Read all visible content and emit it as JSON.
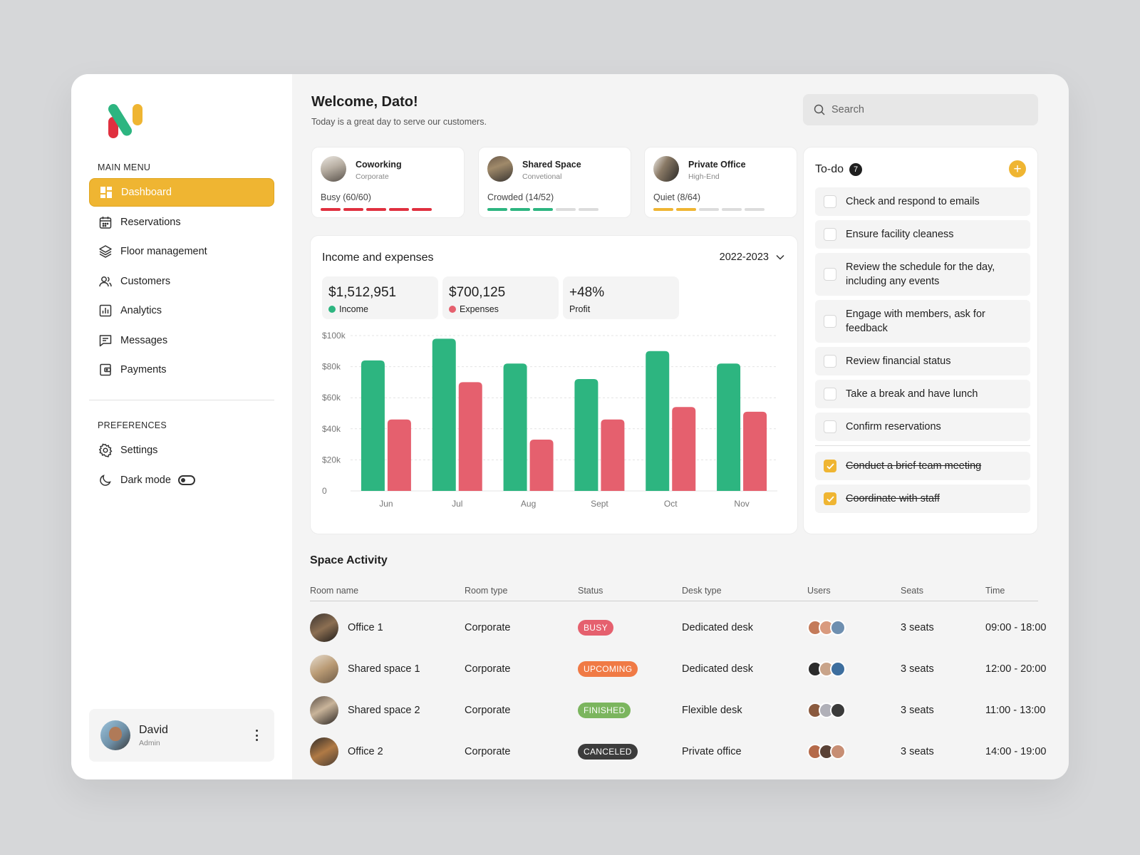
{
  "sidebar": {
    "main_menu_title": "MAIN MENU",
    "preferences_title": "PREFERENCES",
    "items": [
      {
        "label": "Dashboard",
        "icon": "dashboard-icon"
      },
      {
        "label": "Reservations",
        "icon": "calendar-icon"
      },
      {
        "label": "Floor management",
        "icon": "layers-icon"
      },
      {
        "label": "Customers",
        "icon": "users-icon"
      },
      {
        "label": "Analytics",
        "icon": "analytics-icon"
      },
      {
        "label": "Messages",
        "icon": "message-icon"
      },
      {
        "label": "Payments",
        "icon": "wallet-icon"
      }
    ],
    "prefs": [
      {
        "label": "Settings",
        "icon": "gear-icon"
      },
      {
        "label": "Dark mode",
        "icon": "moon-icon"
      }
    ],
    "user": {
      "name": "David",
      "role": "Admin"
    }
  },
  "header": {
    "welcome": "Welcome, Dato!",
    "subtitle": "Today is a great day to serve our customers.",
    "search_placeholder": "Search"
  },
  "spaces": [
    {
      "name": "Coworking",
      "type": "Corporate",
      "status": "Busy (60/60)",
      "filled": 5,
      "color": "#e0303f"
    },
    {
      "name": "Shared Space",
      "type": "Convetional",
      "status": "Crowded (14/52)",
      "filled": 3,
      "color": "#2db580"
    },
    {
      "name": "Private Office",
      "type": "High-End",
      "status": "Quiet (8/64)",
      "filled": 2,
      "color": "#efb532"
    }
  ],
  "income": {
    "title": "Income and expenses",
    "period": "2022-2023",
    "stats": [
      {
        "value": "$1,512,951",
        "label": "Income"
      },
      {
        "value": "$700,125",
        "label": "Expenses"
      },
      {
        "value": "+48%",
        "label": "Profit"
      }
    ]
  },
  "chart_data": {
    "type": "bar",
    "categories": [
      "Jun",
      "Jul",
      "Aug",
      "Sept",
      "Oct",
      "Nov"
    ],
    "series": [
      {
        "name": "Income",
        "color": "#2db580",
        "values": [
          84000,
          98000,
          82000,
          72000,
          90000,
          82000
        ]
      },
      {
        "name": "Expenses",
        "color": "#e5606e",
        "values": [
          46000,
          70000,
          33000,
          46000,
          54000,
          51000
        ]
      }
    ],
    "ylim": [
      0,
      100000
    ],
    "yticks": [
      "0",
      "$20k",
      "$40k",
      "$60k",
      "$80k",
      "$100k"
    ],
    "grid": true
  },
  "todo": {
    "title": "To-do",
    "count": "7",
    "add_label": "+",
    "items": [
      {
        "text": "Check and respond to emails",
        "done": false
      },
      {
        "text": "Ensure facility cleaness",
        "done": false
      },
      {
        "text": "Review the schedule for the day, including any events",
        "done": false
      },
      {
        "text": "Engage with members, ask for feedback",
        "done": false
      },
      {
        "text": "Review financial status",
        "done": false
      },
      {
        "text": "Take a break and have lunch",
        "done": false
      },
      {
        "text": "Confirm reservations",
        "done": false
      },
      {
        "text": "Conduct a brief team meeting",
        "done": true
      },
      {
        "text": "Coordinate with staff",
        "done": true
      }
    ]
  },
  "activity": {
    "title": "Space Activity",
    "columns": [
      "Room name",
      "Room type",
      "Status",
      "Desk type",
      "Users",
      "Seats",
      "Time"
    ],
    "rows": [
      {
        "room": "Office 1",
        "type": "Corporate",
        "status": "BUSY",
        "status_color": "#e5606e",
        "desk": "Dedicated desk",
        "seats": "3 seats",
        "time": "09:00 - 18:00"
      },
      {
        "room": "Shared space 1",
        "type": "Corporate",
        "status": "UPCOMING",
        "status_color": "#f07a45",
        "desk": "Dedicated desk",
        "seats": "3 seats",
        "time": "12:00 - 20:00"
      },
      {
        "room": "Shared space 2",
        "type": "Corporate",
        "status": "FINISHED",
        "status_color": "#7bb55e",
        "desk": "Flexible desk",
        "seats": "3 seats",
        "time": "11:00 - 13:00"
      },
      {
        "room": "Office 2",
        "type": "Corporate",
        "status": "CANCELED",
        "status_color": "#3c3c3c",
        "desk": "Private office",
        "seats": "3 seats",
        "time": "14:00 - 19:00"
      }
    ]
  }
}
